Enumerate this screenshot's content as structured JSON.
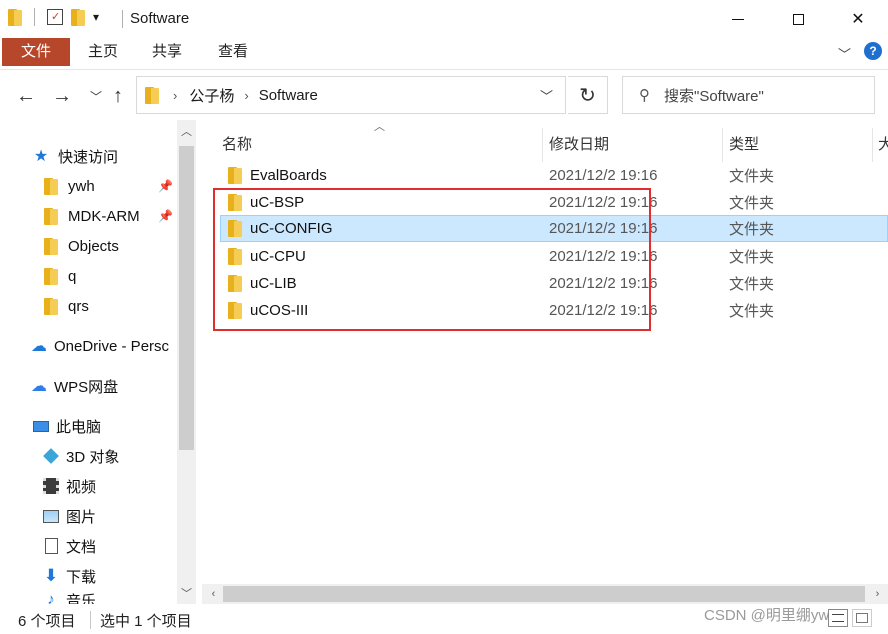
{
  "window": {
    "title": "Software",
    "quick_access_toolbar_dropdown": "▾"
  },
  "ribbon": {
    "tabs": [
      "文件",
      "主页",
      "共享",
      "查看"
    ]
  },
  "address": {
    "path": [
      "公子杨",
      "Software"
    ],
    "search_placeholder": "搜索\"Software\""
  },
  "sidebar": {
    "quick_access_label": "快速访问",
    "pinned": [
      "ywh",
      "MDK-ARM",
      "Objects",
      "q",
      "qrs"
    ],
    "onedrive": "OneDrive - Persc",
    "wps": "WPS网盘",
    "this_pc": "此电脑",
    "pc_items": [
      "3D 对象",
      "视频",
      "图片",
      "文档",
      "下载",
      "音乐"
    ]
  },
  "columns": {
    "name": "名称",
    "date": "修改日期",
    "type": "类型",
    "size": "大"
  },
  "files": [
    {
      "name": "EvalBoards",
      "date": "2021/12/2 19:16",
      "type": "文件夹"
    },
    {
      "name": "uC-BSP",
      "date": "2021/12/2 19:16",
      "type": "文件夹"
    },
    {
      "name": "uC-CONFIG",
      "date": "2021/12/2 19:16",
      "type": "文件夹"
    },
    {
      "name": "uC-CPU",
      "date": "2021/12/2 19:16",
      "type": "文件夹"
    },
    {
      "name": "uC-LIB",
      "date": "2021/12/2 19:16",
      "type": "文件夹"
    },
    {
      "name": "uCOS-III",
      "date": "2021/12/2 19:16",
      "type": "文件夹"
    }
  ],
  "selected_file": "uC-CONFIG",
  "status": {
    "item_count": "6 个项目",
    "selected": "选中 1 个项目"
  },
  "watermark": "CSDN @明里绷ywh",
  "colors": {
    "file_tab": "#b7472a",
    "selection": "#cce8ff",
    "highlight": "#e02d2d",
    "folder": "#f5cd55"
  }
}
